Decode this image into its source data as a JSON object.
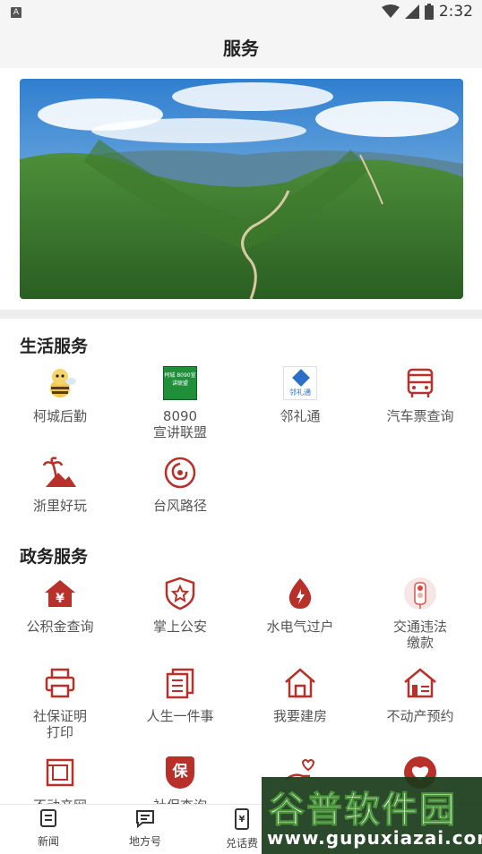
{
  "status_bar": {
    "time": "2:32",
    "notification_letter": "A"
  },
  "header": {
    "title": "服务"
  },
  "life_services": {
    "title": "生活服务",
    "items": [
      {
        "label": "柯城后勤",
        "icon": "bee-mascot-icon"
      },
      {
        "label": "8090\n宣讲联盟",
        "icon": "8090-alliance-logo-icon",
        "logo_text": "柯城 8090宣讲联盟"
      },
      {
        "label": "邻礼通",
        "icon": "linlitong-logo-icon",
        "logo_text": "邻礼通"
      },
      {
        "label": "汽车票查询",
        "icon": "bus-icon"
      },
      {
        "label": "浙里好玩",
        "icon": "palm-tree-icon"
      },
      {
        "label": "台风路径",
        "icon": "typhoon-icon"
      }
    ]
  },
  "gov_services": {
    "title": "政务服务",
    "items": [
      {
        "label": "公积金查询",
        "icon": "yuan-house-icon"
      },
      {
        "label": "掌上公安",
        "icon": "police-badge-icon"
      },
      {
        "label": "水电气过户",
        "icon": "drop-icon"
      },
      {
        "label": "交通违法\n缴款",
        "icon": "traffic-light-icon"
      },
      {
        "label": "社保证明\n打印",
        "icon": "printer-icon"
      },
      {
        "label": "人生一件事",
        "icon": "documents-icon"
      },
      {
        "label": "我要建房",
        "icon": "house-icon"
      },
      {
        "label": "不动产预约",
        "icon": "property-icon"
      },
      {
        "label": "不动产网",
        "icon": "blueprint-icon"
      },
      {
        "label": "社保查询",
        "icon": "bao-shield-icon",
        "icon_text": "保"
      },
      {
        "label": "",
        "icon": "hand-heart-icon"
      },
      {
        "label": "",
        "icon": "heart-circle-icon"
      }
    ]
  },
  "tabbar": {
    "items": [
      {
        "label": "新闻",
        "icon": "news-icon"
      },
      {
        "label": "地方号",
        "icon": "chat-icon"
      },
      {
        "label": "兑话费",
        "icon": "phone-yuan-icon"
      },
      {
        "label": "",
        "icon": "service-icon"
      },
      {
        "label": "",
        "icon": "user-icon"
      }
    ]
  },
  "watermark": {
    "text": "谷普软件园",
    "url": "www.gupuxiazai.com"
  },
  "colors": {
    "accent": "#c0392b",
    "icon_red": "#b8302a",
    "text_gray": "#555555",
    "divider": "#eeeeee"
  }
}
